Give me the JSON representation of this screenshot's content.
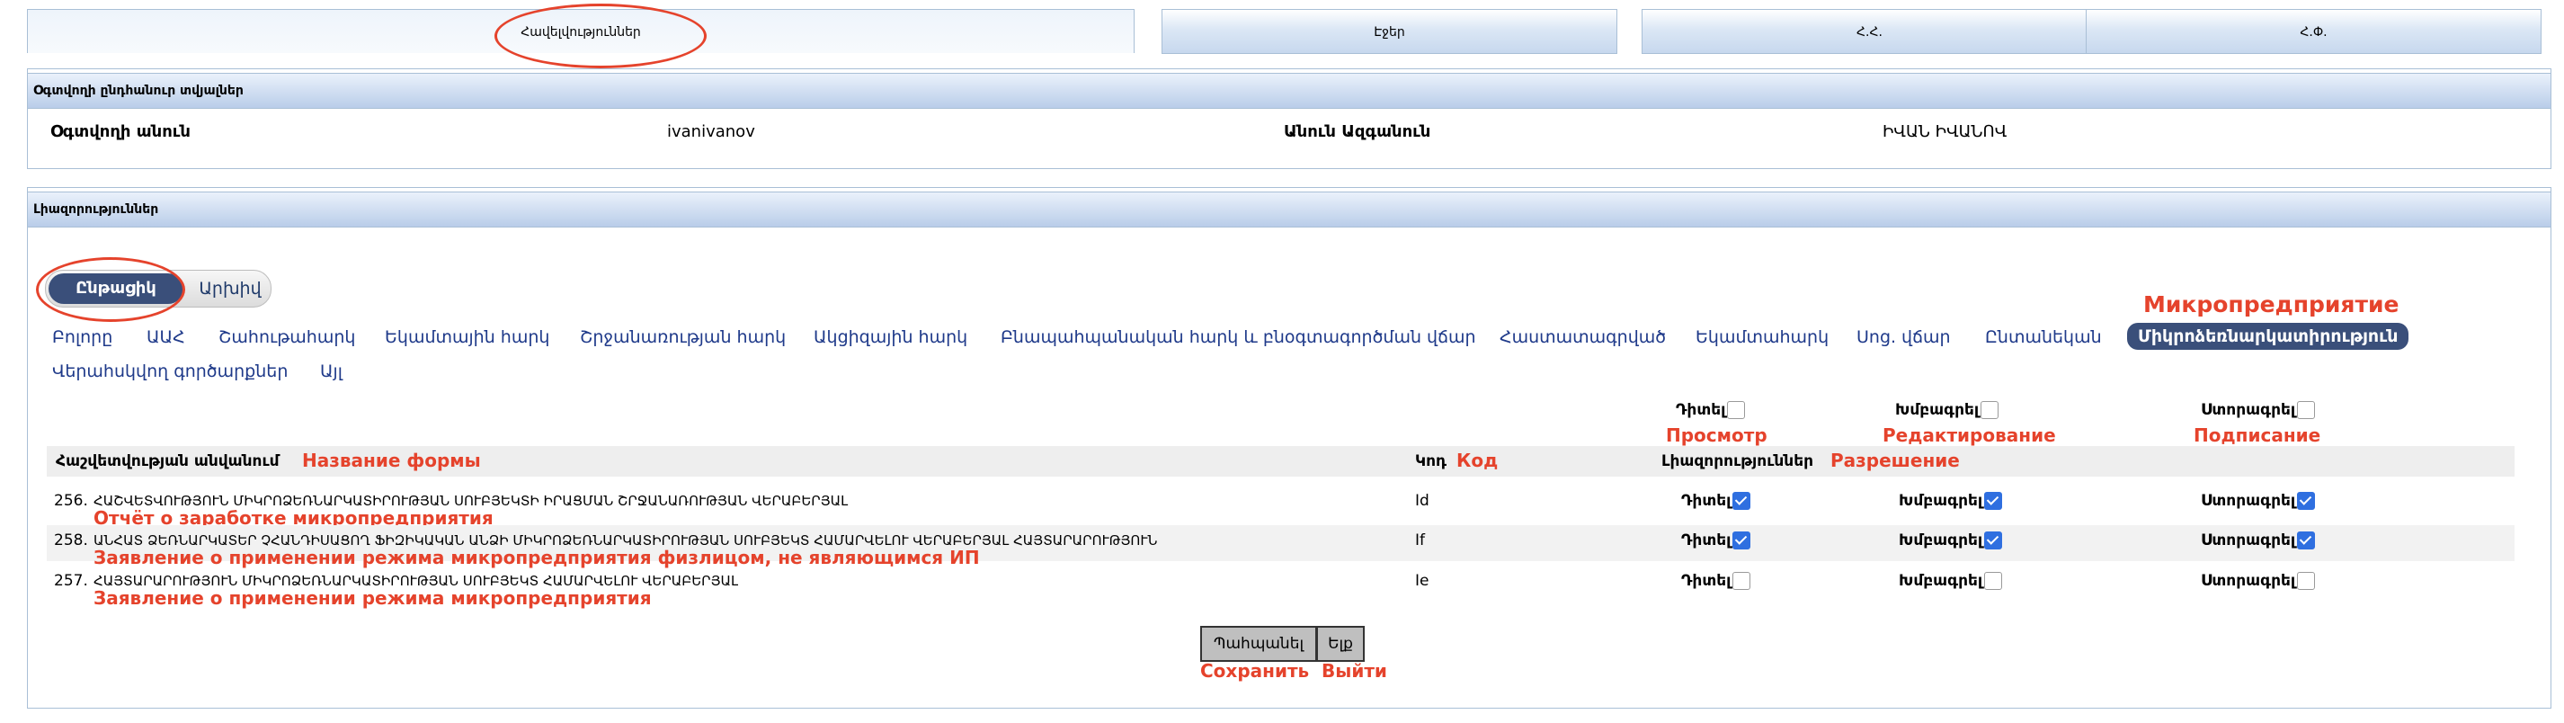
{
  "tabs": [
    {
      "label": "Հավելվություններ",
      "active": true
    },
    {
      "label": "Էջեր",
      "active": false
    },
    {
      "label": "Հ.Հ.",
      "active": false
    },
    {
      "label": "Հ.Փ.",
      "active": false
    }
  ],
  "user_panel": {
    "title": "Օգտվողի ընդհանուր տվյալներ",
    "username_label": "Օգտվողի անուն",
    "username_value": "ivanivanov",
    "fullname_label": "Անուն Ազգանուն",
    "fullname_value": "ԻՎԱՆ ԻՎԱՆՈՎ"
  },
  "perm_panel": {
    "title": "Լիազորություններ",
    "toggle_on": "Ընթացիկ",
    "toggle_off": "Արխիվ"
  },
  "categories": [
    "Բոլորը",
    "ԱԱՀ",
    "Շահութահարկ",
    "Եկամտային հարկ",
    "Շրջանառության հարկ",
    "Ակցիզային հարկ",
    "Բնապահպանական հարկ և բնօգտագործման վճար",
    "Հաստատագրված",
    "Եկամտահարկ",
    "Սոց. վճար",
    "Ընտանեկան",
    "Միկրոձեռնարկատիրություն",
    "Վերահսկվող գործարքներ",
    "Այլ"
  ],
  "active_category_ru": "Микропредприятие",
  "header_checks": {
    "view": "Դիտել",
    "edit": "Խմբագրել",
    "sign": "Ստորագրել"
  },
  "header_ru": {
    "view": "Просмотр",
    "edit": "Редактирование",
    "sign": "Подписание"
  },
  "table_header": {
    "form_name": "Հաշվետվության անվանում",
    "form_name_ru": "Название формы",
    "code": "Կոդ",
    "code_ru": "Код",
    "permissions": "Լիազորություններ",
    "permissions_ru": "Разрешение"
  },
  "rows": [
    {
      "num": "256.",
      "name": "ՀԱՇՎԵՏՎՈՒԹՅՈՒՆ ՄԻԿՐՈՁԵՌՆԱՐԿԱՏԻՐՈՒԹՅԱՆ ՍՈՒԲՅԵԿՏԻ ԻՐԱՑՄԱՆ ՇՐՋԱՆԱՌՈՒԹՅԱՆ ՎԵՐԱԲԵՐՅԱԼ",
      "name_ru": "Отчёт о заработке микропредприятия",
      "code": "Id",
      "view": true,
      "edit": true,
      "sign": true
    },
    {
      "num": "258.",
      "name": "ԱՆՀԱՏ ՁԵՌՆԱՐԿԱՏԵՐ ՉՀԱՆԴԻՍԱՑՈՂ ՖԻԶԻԿԱԿԱՆ ԱՆՁԻ ՄԻԿՐՈՁԵՌՆԱՐԿԱՏԻՐՈՒԹՅԱՆ ՍՈՒԲՅԵԿՏ ՀԱՄԱՐՎԵԼՈՒ ՎԵՐԱԲԵՐՅԱԼ ՀԱՅՏԱՐԱՐՈՒԹՅՈՒՆ",
      "name_ru": "Заявление о применении режима микропредприятия физлицом, не являющимся ИП",
      "code": "If",
      "view": true,
      "edit": true,
      "sign": true
    },
    {
      "num": "257.",
      "name": "ՀԱՅՏԱՐԱՐՈՒԹՅՈՒՆ ՄԻԿՐՈՁԵՌՆԱՐԿԱՏԻՐՈՒԹՅԱՆ ՍՈՒԲՅԵԿՏ ՀԱՄԱՐՎԵԼՈՒ ՎԵՐԱԲԵՐՅԱԼ",
      "name_ru": "Заявление о применении режима микропредприятия",
      "code": "Ie",
      "view": false,
      "edit": false,
      "sign": false
    }
  ],
  "buttons": {
    "save": "Պահպանել",
    "exit": "Ելք",
    "save_ru": "Сохранить",
    "exit_ru": "Выйти"
  },
  "colors": {
    "annotation": "#e5432c",
    "accent": "#3a4f7a",
    "checkbox_on": "#2f6fe0"
  }
}
